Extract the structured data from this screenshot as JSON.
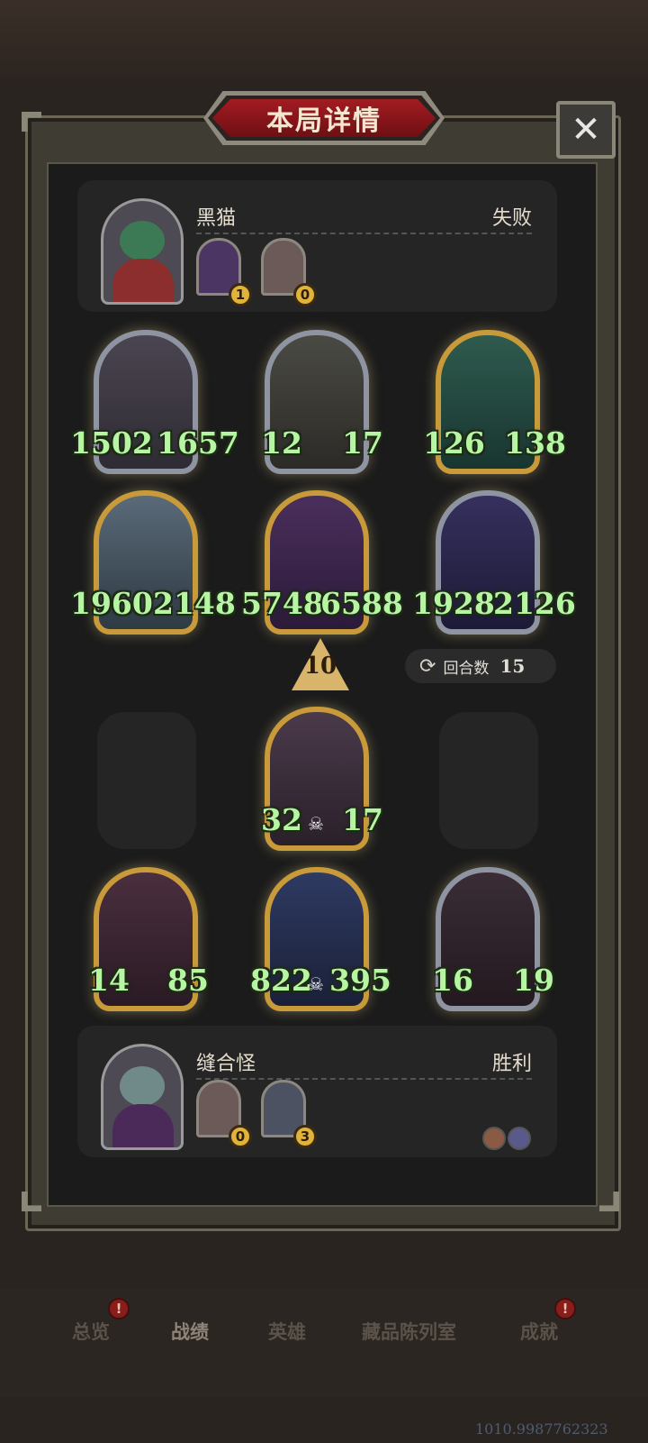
{
  "title": "本局详情",
  "close_label": "✕",
  "opponent": {
    "name": "黑猫",
    "result": "失败",
    "badges": [
      "1",
      "0"
    ]
  },
  "player": {
    "name": "缝合怪",
    "result": "胜利",
    "badges": [
      "0",
      "3"
    ]
  },
  "opponent_board": [
    {
      "attack": "1502",
      "health": "1657"
    },
    {
      "attack": "12",
      "health": "17"
    },
    {
      "attack": "126",
      "health": "138"
    },
    {
      "attack": "1960",
      "health": "2148"
    },
    {
      "attack": "5748",
      "health": "6588"
    },
    {
      "attack": "1928",
      "health": "2126"
    }
  ],
  "level": "10",
  "rounds": {
    "label": "回合数",
    "value": "15",
    "icon": "cycle-icon"
  },
  "player_board": [
    {
      "attack": "32",
      "health": "17"
    },
    {
      "attack": "14",
      "health": "85"
    },
    {
      "attack": "822",
      "health": "395"
    },
    {
      "attack": "16",
      "health": "19"
    }
  ],
  "nav": [
    "总览",
    "战绩",
    "英雄",
    "藏品陈列室",
    "成就"
  ],
  "nav_alerts": [
    "!",
    "!"
  ],
  "user_id": "1010.9987762323"
}
